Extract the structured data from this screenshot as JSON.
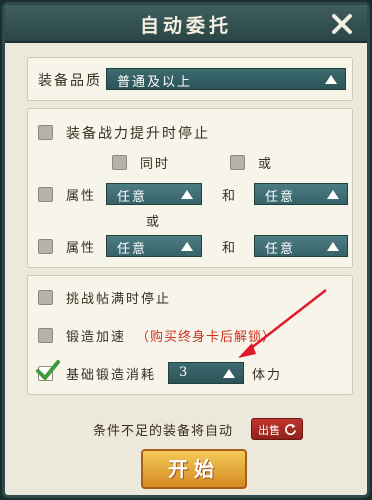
{
  "dialog": {
    "title": "自动委托",
    "close_icon": "close-x-icon"
  },
  "quality": {
    "label": "装备品质",
    "value": "普通及以上"
  },
  "stop_section": {
    "power_up_label": "装备战力提升时停止",
    "mode_same_time": "同时",
    "mode_or": "或",
    "attr_label": "属性",
    "and_label": "和",
    "or_between": "或",
    "attr_rows": [
      {
        "first": "任意",
        "second": "任意"
      },
      {
        "first": "任意",
        "second": "任意"
      }
    ]
  },
  "forge_section": {
    "challenge_full_label": "挑战帖满时停止",
    "forge_speedup_label": "锻造加速",
    "forge_speedup_note": "（购买终身卡后解锁）",
    "base_forge_label": "基础锻造消耗",
    "base_forge_value": "3",
    "stamina_label": "体力"
  },
  "footer": {
    "auto_text": "条件不足的装备将自动",
    "sell_label": "出售",
    "start_label": "开始"
  },
  "colors": {
    "title_bar": "#2f4a4b",
    "panel_bg": "#f7f4ea",
    "select_bg": "#2c5458",
    "annotation_red": "#e0192b",
    "start_gold": "#e3a93c"
  },
  "checkbox_states": {
    "power_up": false,
    "same_time": false,
    "or": false,
    "attr_row_1": false,
    "attr_row_2": false,
    "challenge_full": false,
    "forge_speedup": false,
    "base_forge": true
  }
}
